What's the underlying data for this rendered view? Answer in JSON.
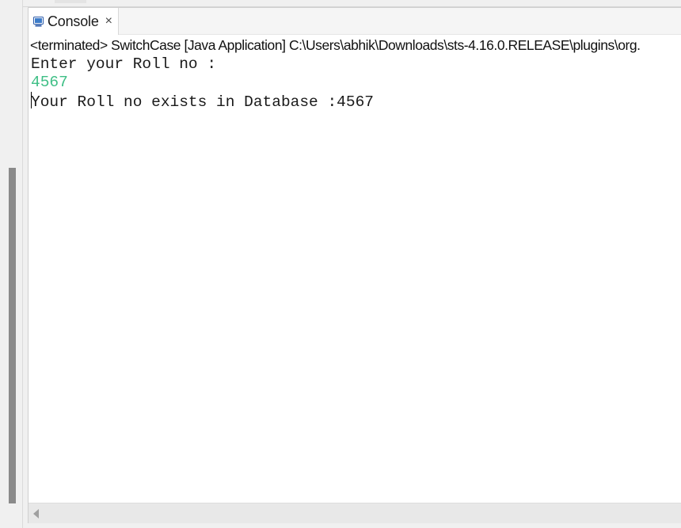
{
  "tab": {
    "label": "Console",
    "close_glyph": "×",
    "icon": "console-icon"
  },
  "status": {
    "text": "<terminated> SwitchCase [Java Application] C:\\Users\\abhik\\Downloads\\sts-4.16.0.RELEASE\\plugins\\org."
  },
  "output": {
    "prompt": "Enter your Roll no :",
    "input_echo": "4567",
    "result": "Your Roll no exists in Database :4567"
  },
  "colors": {
    "input_echo": "#3fbf86",
    "scroll_thumb": "#8a8a8a"
  }
}
